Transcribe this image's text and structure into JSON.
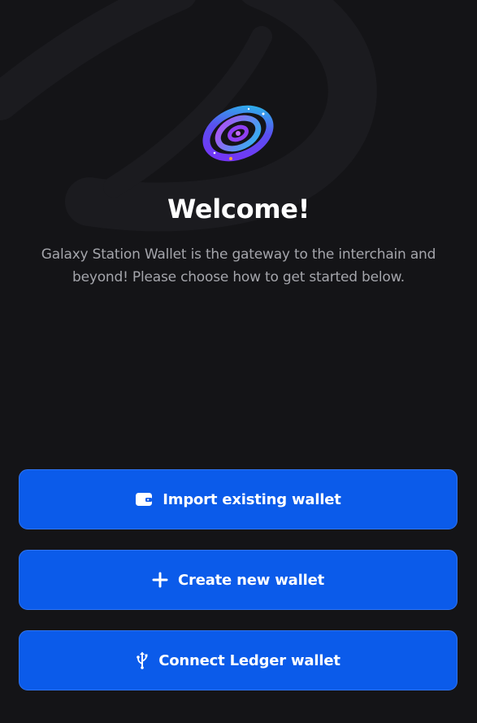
{
  "welcome": {
    "title": "Welcome!",
    "description": "Galaxy Station Wallet is the gateway to the interchain and beyond! Please choose how to get started below."
  },
  "actions": [
    {
      "label": "Import existing wallet",
      "icon": "wallet-icon"
    },
    {
      "label": "Create new wallet",
      "icon": "plus-icon"
    },
    {
      "label": "Connect Ledger wallet",
      "icon": "usb-icon"
    }
  ],
  "colors": {
    "background": "#141417",
    "button": "#0b5bea",
    "title": "#ffffff",
    "subtitle": "#a4a5ab"
  }
}
